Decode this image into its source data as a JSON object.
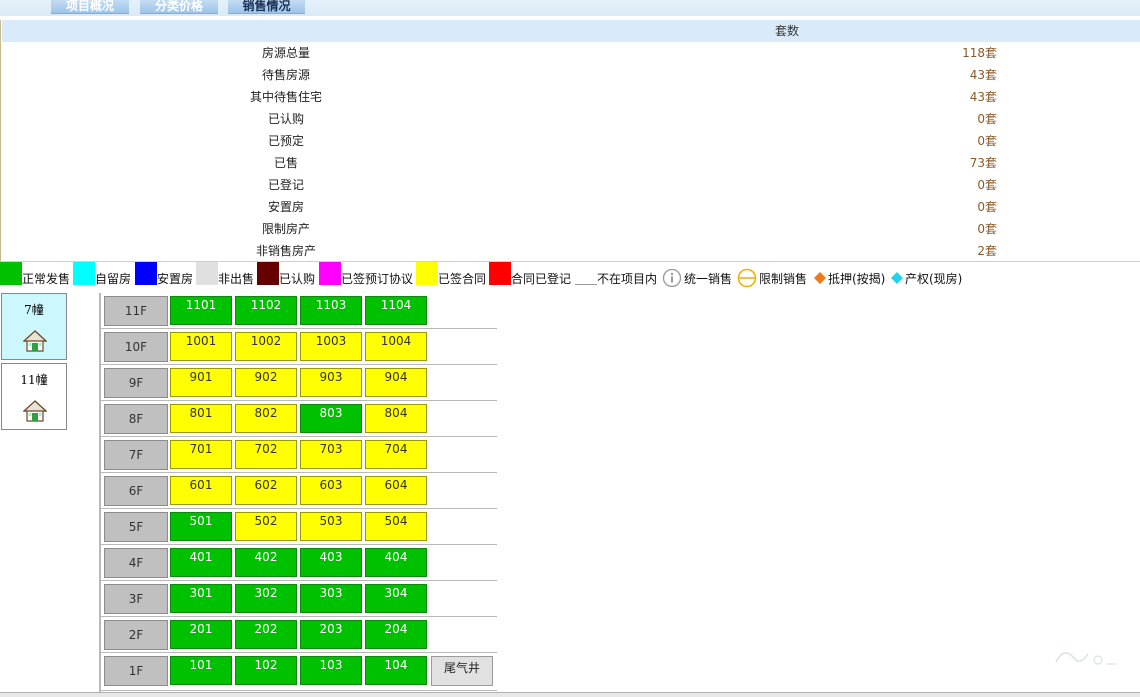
{
  "tabs": [
    {
      "label": "项目概况"
    },
    {
      "label": "分类价格"
    },
    {
      "label": "销售情况"
    }
  ],
  "summary": {
    "header": "套数",
    "rows": [
      {
        "label": "房源总量",
        "value": "118套"
      },
      {
        "label": "待售房源",
        "value": "43套"
      },
      {
        "label": "其中待售住宅",
        "value": "43套"
      },
      {
        "label": "已认购",
        "value": "0套"
      },
      {
        "label": "已预定",
        "value": "0套"
      },
      {
        "label": "已售",
        "value": "73套"
      },
      {
        "label": "已登记",
        "value": "0套"
      },
      {
        "label": "安置房",
        "value": "0套"
      },
      {
        "label": "限制房产",
        "value": "0套"
      },
      {
        "label": "非销售房产",
        "value": "2套"
      }
    ]
  },
  "legend": [
    {
      "label": "正常发售",
      "color": "#00c100"
    },
    {
      "label": "自留房",
      "color": "#00ffff"
    },
    {
      "label": "安置房",
      "color": "#0000ff"
    },
    {
      "label": "非出售",
      "color": "#e0e0e0"
    },
    {
      "label": "已认购",
      "color": "#660000"
    },
    {
      "label": "已签预订协议",
      "color": "#ff00ff"
    },
    {
      "label": "已签合同",
      "color": "#ffff00"
    },
    {
      "label": "合同已登记",
      "color": "#ff0000"
    },
    {
      "label": "不在项目内",
      "color": "#ffffff"
    },
    {
      "label": "统一销售",
      "icon": "info-circle-icon"
    },
    {
      "label": "限制销售",
      "icon": "restricted-circle-icon"
    },
    {
      "label": "抵押(按揭)",
      "icon": "orange-diamond-icon"
    },
    {
      "label": "产权(现房)",
      "icon": "cyan-diamond-icon"
    }
  ],
  "buildings": [
    {
      "name": "7幢",
      "icon": "house-icon",
      "active": true
    },
    {
      "name": "11幢",
      "icon": "house-icon",
      "active": false
    }
  ],
  "floors": [
    {
      "floor": "11F",
      "units": [
        {
          "no": "1101",
          "status": "green"
        },
        {
          "no": "1102",
          "status": "green"
        },
        {
          "no": "1103",
          "status": "green"
        },
        {
          "no": "1104",
          "status": "green"
        }
      ]
    },
    {
      "floor": "10F",
      "units": [
        {
          "no": "1001",
          "status": "yellow"
        },
        {
          "no": "1002",
          "status": "yellow"
        },
        {
          "no": "1003",
          "status": "yellow"
        },
        {
          "no": "1004",
          "status": "yellow"
        }
      ]
    },
    {
      "floor": "9F",
      "units": [
        {
          "no": "901",
          "status": "yellow"
        },
        {
          "no": "902",
          "status": "yellow"
        },
        {
          "no": "903",
          "status": "yellow"
        },
        {
          "no": "904",
          "status": "yellow"
        }
      ]
    },
    {
      "floor": "8F",
      "units": [
        {
          "no": "801",
          "status": "yellow"
        },
        {
          "no": "802",
          "status": "yellow"
        },
        {
          "no": "803",
          "status": "green"
        },
        {
          "no": "804",
          "status": "yellow"
        }
      ]
    },
    {
      "floor": "7F",
      "units": [
        {
          "no": "701",
          "status": "yellow"
        },
        {
          "no": "702",
          "status": "yellow"
        },
        {
          "no": "703",
          "status": "yellow"
        },
        {
          "no": "704",
          "status": "yellow"
        }
      ]
    },
    {
      "floor": "6F",
      "units": [
        {
          "no": "601",
          "status": "yellow"
        },
        {
          "no": "602",
          "status": "yellow"
        },
        {
          "no": "603",
          "status": "yellow"
        },
        {
          "no": "604",
          "status": "yellow"
        }
      ]
    },
    {
      "floor": "5F",
      "units": [
        {
          "no": "501",
          "status": "green"
        },
        {
          "no": "502",
          "status": "yellow"
        },
        {
          "no": "503",
          "status": "yellow"
        },
        {
          "no": "504",
          "status": "yellow"
        }
      ]
    },
    {
      "floor": "4F",
      "units": [
        {
          "no": "401",
          "status": "green"
        },
        {
          "no": "402",
          "status": "green"
        },
        {
          "no": "403",
          "status": "green"
        },
        {
          "no": "404",
          "status": "green"
        }
      ]
    },
    {
      "floor": "3F",
      "units": [
        {
          "no": "301",
          "status": "green"
        },
        {
          "no": "302",
          "status": "green"
        },
        {
          "no": "303",
          "status": "green"
        },
        {
          "no": "304",
          "status": "green"
        }
      ]
    },
    {
      "floor": "2F",
      "units": [
        {
          "no": "201",
          "status": "green"
        },
        {
          "no": "202",
          "status": "green"
        },
        {
          "no": "203",
          "status": "green"
        },
        {
          "no": "204",
          "status": "green"
        }
      ]
    },
    {
      "floor": "1F",
      "units": [
        {
          "no": "101",
          "status": "green"
        },
        {
          "no": "102",
          "status": "green"
        },
        {
          "no": "103",
          "status": "green"
        },
        {
          "no": "104",
          "status": "green"
        }
      ],
      "extra": "尾气井"
    }
  ]
}
